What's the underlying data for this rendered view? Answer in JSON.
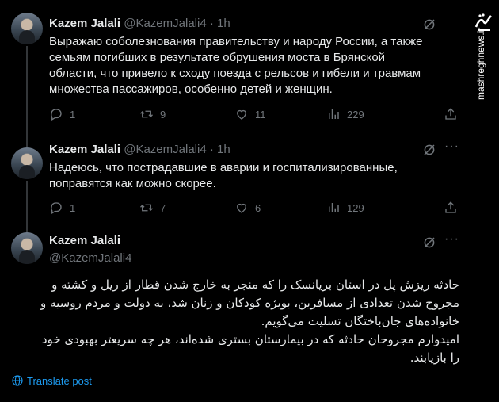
{
  "colors": {
    "background": "#000000",
    "text": "#e7e9ea",
    "muted": "#71767b",
    "link": "#1d9bf0",
    "divider": "#333639"
  },
  "tweets": [
    {
      "name": "Kazem Jalali",
      "handle": "@KazemJalali4",
      "time": "· 1h",
      "text": "Выражаю соболезнования правительству и народу России, а также семьям погибших в результате обрушения моста в Брянской области, что привело к сходу поезда с рельсов и гибели и травмам множества пассажиров, особенно детей и женщин.",
      "replies": "1",
      "reposts": "9",
      "likes": "11",
      "views": "229"
    },
    {
      "name": "Kazem Jalali",
      "handle": "@KazemJalali4",
      "time": "· 1h",
      "text": "Надеюсь, что пострадавшие в аварии и госпитализированные, поправятся как можно скорее.",
      "replies": "1",
      "reposts": "7",
      "likes": "6",
      "views": "129"
    }
  ],
  "main_tweet": {
    "name": "Kazem Jalali",
    "handle": "@KazemJalali4",
    "paragraph1": "حادثه ریزش پل در استان بریانسک را که منجر به خارج شدن قطار از ریل و کشته و مجروح شدن تعدادی از مسافرین، بویژه کودکان و زنان شد، به دولت و مردم روسیه و خانواده‌های جان‌باختگان تسلیت می‌گویم.",
    "paragraph2": "امیدوارم مجروحان حادثه که در بیمارستان بستری شده‌اند، هر چه سریعتر بهبودی خود را بازیابند.",
    "translate_label": "Translate post"
  },
  "watermark": {
    "site": "mashreghnews.ir",
    "logo_text": "مشرق"
  },
  "icons": [
    "grok-icon",
    "more-icon",
    "reply-icon",
    "repost-icon",
    "like-icon",
    "views-icon",
    "share-icon",
    "globe-icon"
  ]
}
